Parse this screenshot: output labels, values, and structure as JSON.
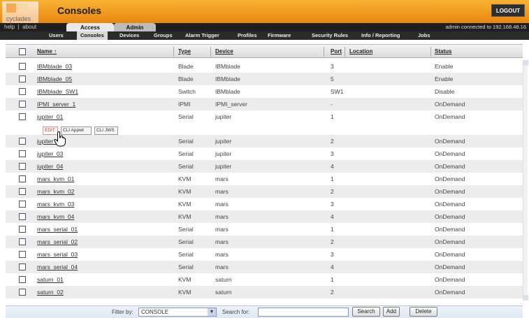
{
  "header": {
    "brand": "cyclades",
    "title": "Consoles",
    "logout_label": "LOGOUT"
  },
  "nav": {
    "help_link": "help",
    "about_link": "about",
    "link_sep": "|",
    "tabs": [
      {
        "label": "Access"
      },
      {
        "label": "Admin"
      }
    ],
    "connection_status": "admin connected to 192.168.48.16"
  },
  "subnav": {
    "items": [
      {
        "label": "Users"
      },
      {
        "label": "Consoles"
      },
      {
        "label": "Devices"
      },
      {
        "label": "Groups"
      },
      {
        "label": "Alarm Trigger"
      },
      {
        "label": "Profiles"
      },
      {
        "label": "Firmware"
      },
      {
        "label": "Security Rules"
      },
      {
        "label": "Info / Reporting"
      },
      {
        "label": "Jobs"
      }
    ]
  },
  "table": {
    "columns": {
      "name": "Name ↑",
      "type": "Type",
      "device": "Device",
      "port": "Port",
      "location": "Location",
      "status": "Status"
    },
    "rows": [
      {
        "name": "IBMblade_03",
        "type": "Blade",
        "device": "IBMblade",
        "port": "3",
        "status": "Enable"
      },
      {
        "name": "IBMblade_05",
        "type": "Blade",
        "device": "IBMblade",
        "port": "5",
        "status": "Enable"
      },
      {
        "name": "IBMblade_SW1",
        "type": "Switch",
        "device": "IBMblade",
        "port": "SW1",
        "status": "Disable"
      },
      {
        "name": "IPMI_server_1",
        "type": "IPMI",
        "device": "IPMI_server",
        "port": "-",
        "status": "OnDemand"
      },
      {
        "name": "jupiter_01",
        "type": "Serial",
        "device": "jupiter",
        "port": "1",
        "status": "OnDemand"
      },
      {
        "name": "jupiter_02",
        "type": "Serial",
        "device": "jupiter",
        "port": "2",
        "status": "OnDemand"
      },
      {
        "name": "jupiter_03",
        "type": "Serial",
        "device": "jupiter",
        "port": "3",
        "status": "OnDemand"
      },
      {
        "name": "jupiter_04",
        "type": "Serial",
        "device": "jupiter",
        "port": "4",
        "status": "OnDemand"
      },
      {
        "name": "mars_kvm_01",
        "type": "KVM",
        "device": "mars",
        "port": "1",
        "status": "OnDemand"
      },
      {
        "name": "mars_kvm_02",
        "type": "KVM",
        "device": "mars",
        "port": "2",
        "status": "OnDemand"
      },
      {
        "name": "mars_kvm_03",
        "type": "KVM",
        "device": "mars",
        "port": "3",
        "status": "OnDemand"
      },
      {
        "name": "mars_kvm_04",
        "type": "KVM",
        "device": "mars",
        "port": "4",
        "status": "OnDemand"
      },
      {
        "name": "mars_serial_01",
        "type": "Serial",
        "device": "mars",
        "port": "1",
        "status": "OnDemand"
      },
      {
        "name": "mars_serial_02",
        "type": "Serial",
        "device": "mars",
        "port": "2",
        "status": "OnDemand"
      },
      {
        "name": "mars_serial_03",
        "type": "Serial",
        "device": "mars",
        "port": "3",
        "status": "OnDemand"
      },
      {
        "name": "mars_serial_04",
        "type": "Serial",
        "device": "mars",
        "port": "4",
        "status": "OnDemand"
      },
      {
        "name": "saturn_01",
        "type": "KVM",
        "device": "saturn",
        "port": "1",
        "status": "OnDemand"
      },
      {
        "name": "saturn_02",
        "type": "KVM",
        "device": "saturn",
        "port": "2",
        "status": "OnDemand"
      }
    ],
    "row_actions": {
      "edit": "EDIT",
      "cli_applet": "CLI Applet",
      "cli_jws": "CLI JWS"
    }
  },
  "footer": {
    "filter_label": "Filter by:",
    "filter_value": "CONSOLE",
    "search_label": "Search for:",
    "search_value": "",
    "search_button": "Search",
    "add_button": "Add",
    "delete_button": "Delete"
  },
  "colors": {
    "header_orange": "#f3a021",
    "nav_dark": "#1f1f1f",
    "row_alt": "#ececec"
  }
}
